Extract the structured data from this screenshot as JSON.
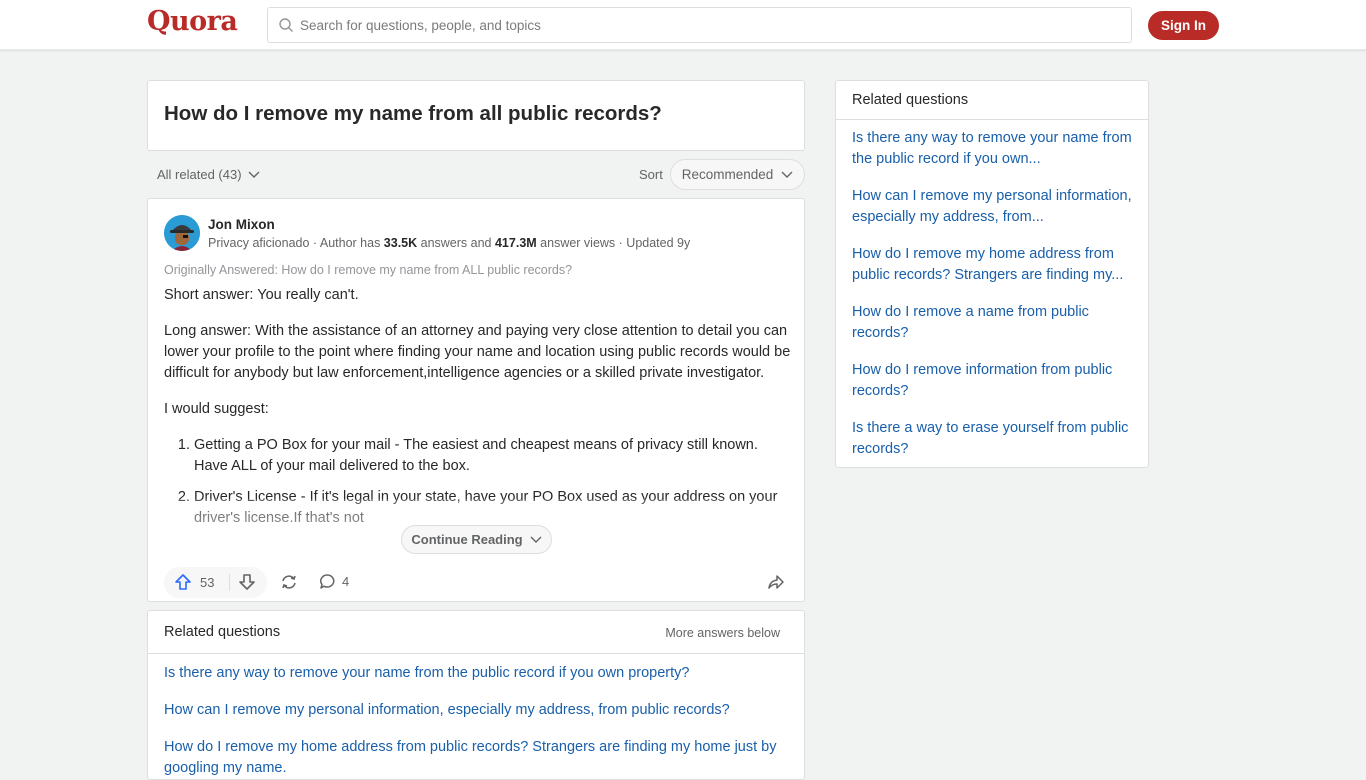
{
  "header": {
    "logo": "Quora",
    "search_placeholder": "Search for questions, people, and topics",
    "signin_label": "Sign In"
  },
  "question": {
    "title": "How do I remove my name from all public records?"
  },
  "filter": {
    "all_related": "All related (43)",
    "sort_label": "Sort",
    "sort_value": "Recommended"
  },
  "answer": {
    "author": "Jon Mixon",
    "meta_prefix": "Privacy aficionado · Author has ",
    "answers_count": "33.5K",
    "meta_mid": " answers and ",
    "views_count": "417.3M",
    "meta_suffix": " answer views · Updated 9y",
    "originally_answered": "Originally Answered: How do I remove my name from ALL public records?",
    "paragraphs": [
      "Short answer: You really can't.",
      "Long answer: With the assistance of an attorney and paying very close attention to detail you can lower your profile to the point where finding your name and location using public records would be difficult for anybody but law enforcement,intelligence agencies or a skilled private investigator.",
      "I would suggest:"
    ],
    "list_items": [
      "Getting a PO Box for your mail - The easiest and cheapest means of privacy still known. Have ALL of your mail delivered to the box.",
      "Driver's License - If it's legal in your state, have your PO Box used as your address on your driver's license.If that's not"
    ],
    "continue_reading": "Continue Reading",
    "upvotes": "53",
    "comments": "4"
  },
  "related_inline": {
    "title": "Related questions",
    "more": "More answers below",
    "items": [
      "Is there any way to remove your name from the public record if you own property?",
      "How can I remove my personal information, especially my address, from public records?",
      "How do I remove my home address from public records? Strangers are finding my home just by googling my name."
    ]
  },
  "related_sidebar": {
    "title": "Related questions",
    "items": [
      "Is there any way to remove your name from the public record if you own...",
      "How can I remove my personal information, especially my address, from...",
      "How do I remove my home address from public records? Strangers are finding my...",
      "How do I remove a name from public records?",
      "How do I remove information from public records?",
      "Is there a way to erase yourself from public records?"
    ]
  },
  "colors": {
    "brand": "#b92b27",
    "link": "#195faa",
    "upvote": "#2e69ff"
  }
}
